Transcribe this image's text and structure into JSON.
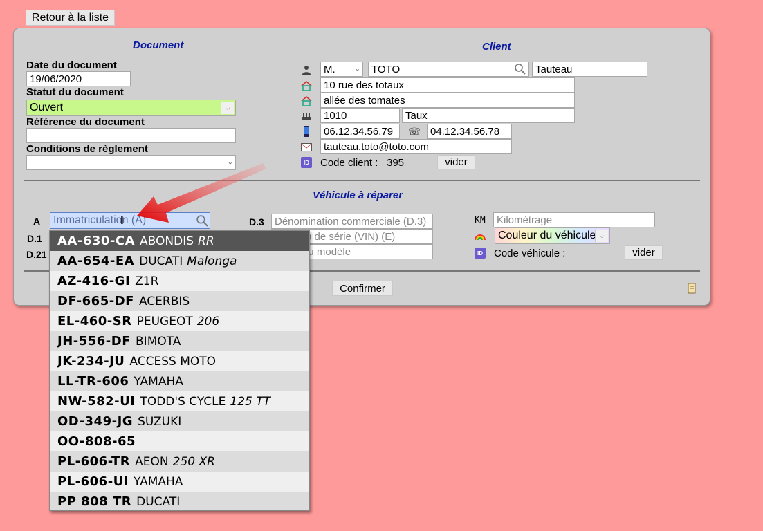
{
  "back_button": "Retour à la liste",
  "document": {
    "title": "Document",
    "date_label": "Date du document",
    "date_value": "19/06/2020",
    "status_label": "Statut du document",
    "status_value": "Ouvert",
    "reference_label": "Référence du document",
    "reference_value": "",
    "payment_label": "Conditions de règlement",
    "payment_value": ""
  },
  "client": {
    "title": "Client",
    "civility": "M.",
    "lastname": "TOTO",
    "firstname": "Tauteau",
    "address1": "10 rue des totaux",
    "address2": "allée des tomates",
    "postcode": "1010",
    "city": "Taux",
    "mobile": "06.12.34.56.79",
    "phone": "04.12.34.56.78",
    "email": "tauteau.toto@toto.com",
    "code_label": "Code client :",
    "code_value": "395",
    "clear_button": "vider"
  },
  "vehicle": {
    "title": "Véhicule à réparer",
    "label_a": "A",
    "label_d1": "D.1",
    "label_d21": "D.21",
    "label_d3": "D.3",
    "plate_placeholder": "Immatriculation (A)",
    "d3_placeholder": "Dénomination commerciale (D.3)",
    "vin_placeholder": "Numéro de série (VIN) (E)",
    "model_placeholder": "Code du modèle",
    "km_label": "KM",
    "km_placeholder": "Kilométrage",
    "color_value": "Couleur du véhicule",
    "code_label": "Code véhicule :",
    "clear_button": "vider"
  },
  "confirm_button": "Confirmer",
  "dropdown": [
    {
      "plate": "AA-630-CA",
      "brand": "ABONDIS",
      "model": "RR"
    },
    {
      "plate": "AA-654-EA",
      "brand": "DUCATI",
      "model": "Malonga"
    },
    {
      "plate": "AZ-416-GI",
      "brand": "Z1R",
      "model": ""
    },
    {
      "plate": "DF-665-DF",
      "brand": "ACERBIS",
      "model": ""
    },
    {
      "plate": "EL-460-SR",
      "brand": "PEUGEOT",
      "model": "206"
    },
    {
      "plate": "JH-556-DF",
      "brand": "BIMOTA",
      "model": ""
    },
    {
      "plate": "JK-234-JU",
      "brand": "ACCESS MOTO",
      "model": ""
    },
    {
      "plate": "LL-TR-606",
      "brand": "YAMAHA",
      "model": ""
    },
    {
      "plate": "NW-582-UI",
      "brand": "TODD'S CYCLE",
      "model": "125 TT"
    },
    {
      "plate": "OD-349-JG",
      "brand": "SUZUKI",
      "model": ""
    },
    {
      "plate": "OO-808-65",
      "brand": "",
      "model": ""
    },
    {
      "plate": "PL-606-TR",
      "brand": "AEON",
      "model": "250 XR"
    },
    {
      "plate": "PL-606-UI",
      "brand": "YAMAHA",
      "model": ""
    },
    {
      "plate": "PP 808 TR",
      "brand": "DUCATI",
      "model": ""
    }
  ],
  "colors": {
    "background": "#ff9a9a",
    "panel": "#d0d0d0",
    "title": "#0a1aa0",
    "status_field": "#c8f78c",
    "arrow": "#e00000"
  }
}
